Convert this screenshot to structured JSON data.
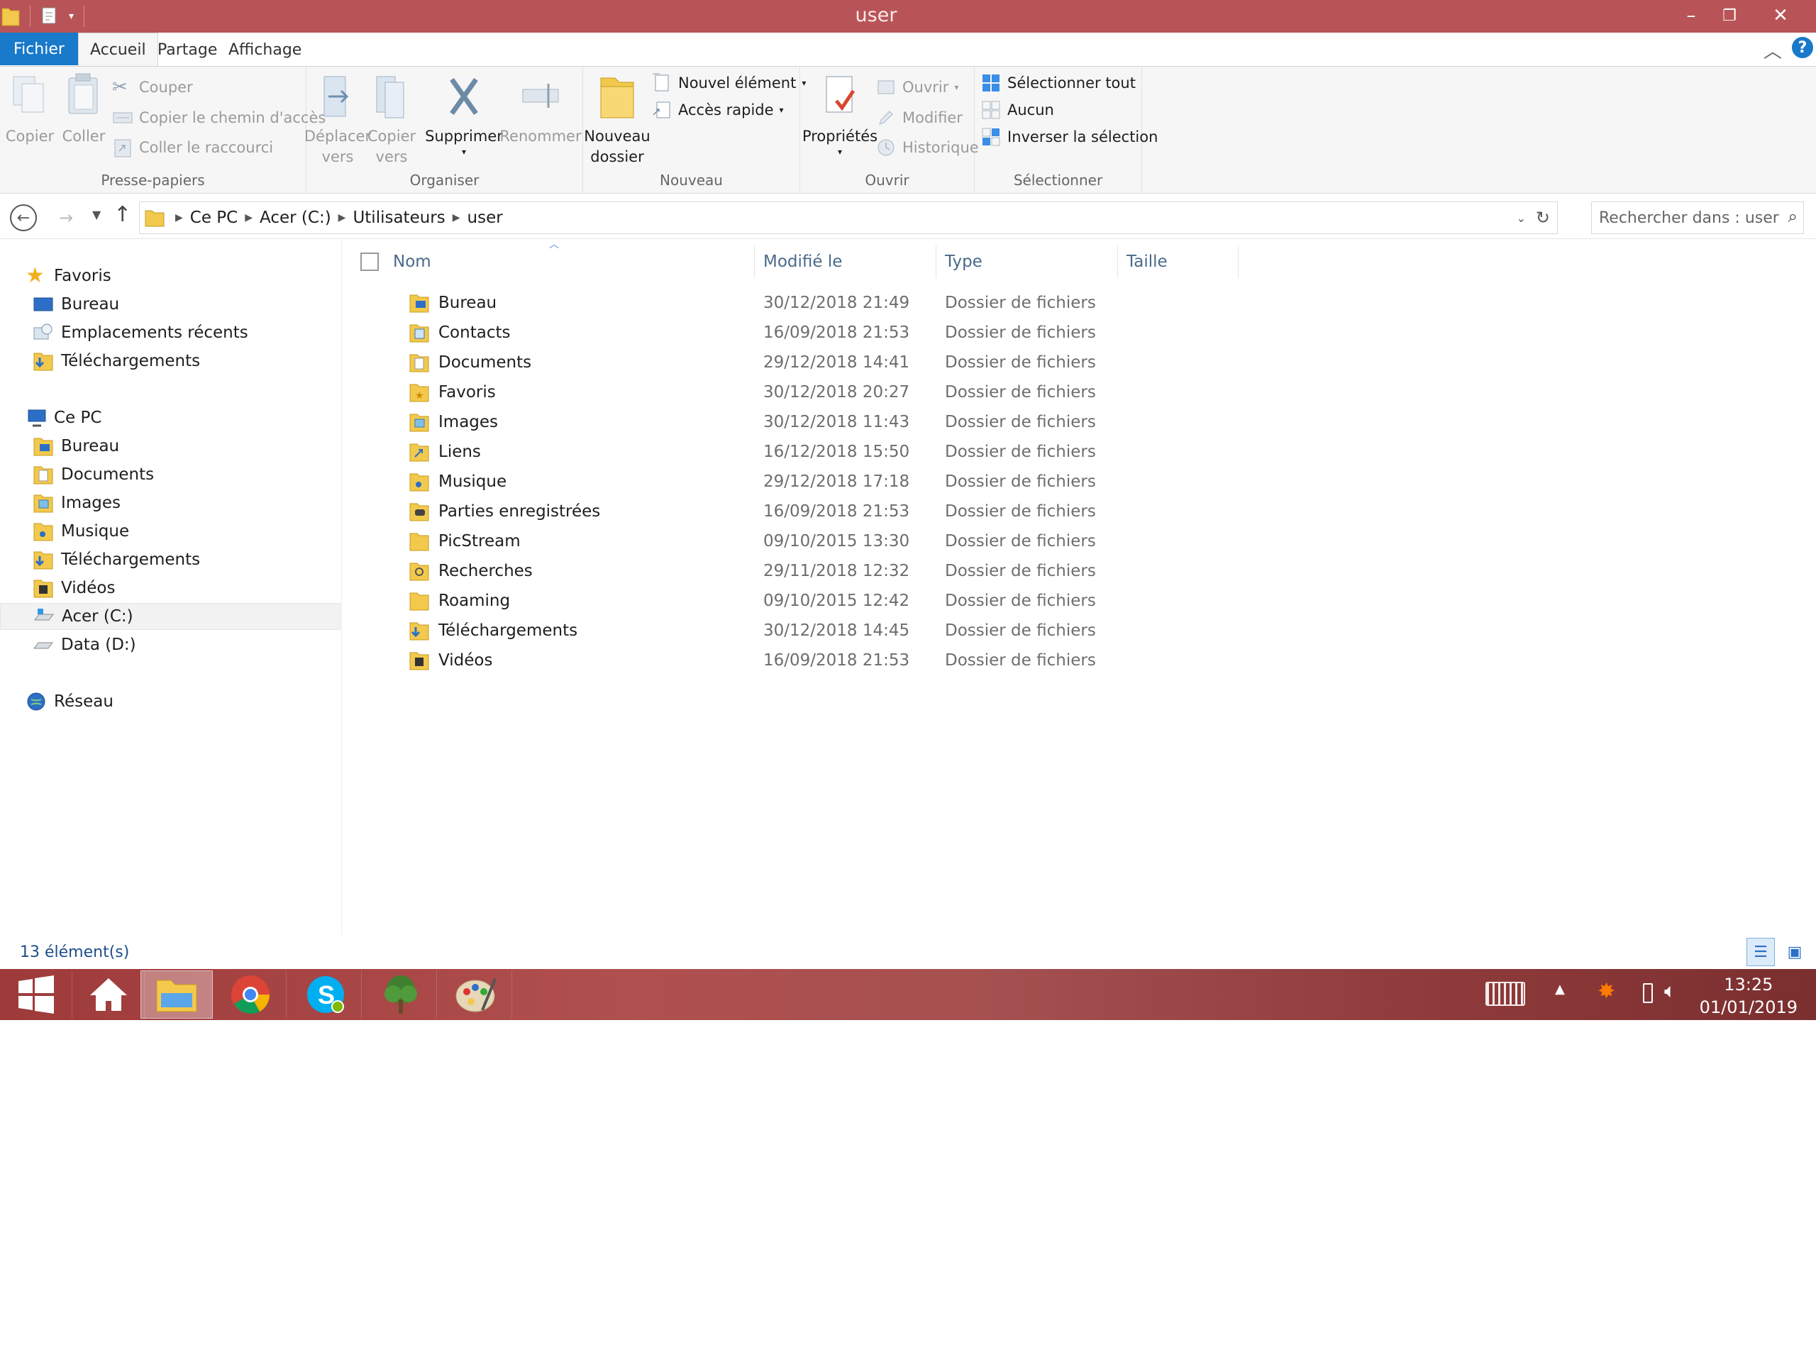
{
  "window": {
    "title": "user"
  },
  "colors": {
    "titlebar": "#b85457",
    "accent": "#1979ca",
    "taskbar": "#9e3a3a"
  },
  "ribbon_tabs": [
    "Fichier",
    "Accueil",
    "Partage",
    "Affichage"
  ],
  "ribbon": {
    "presse_papiers": {
      "label": "Presse-papiers",
      "copier": "Copier",
      "coller": "Coller",
      "couper": "Couper",
      "copier_chemin": "Copier le chemin d'accès",
      "coller_raccourci": "Coller le raccourci"
    },
    "organiser": {
      "label": "Organiser",
      "deplacer_1": "Déplacer",
      "deplacer_2": "vers",
      "copier_1": "Copier",
      "copier_2": "vers",
      "supprimer": "Supprimer",
      "renommer": "Renommer"
    },
    "nouveau": {
      "label": "Nouveau",
      "dossier_1": "Nouveau",
      "dossier_2": "dossier",
      "element": "Nouvel élément",
      "acces": "Accès rapide"
    },
    "ouvrir": {
      "label": "Ouvrir",
      "proprietes": "Propriétés",
      "ouvrir": "Ouvrir",
      "modifier": "Modifier",
      "historique": "Historique"
    },
    "selectionner": {
      "label": "Sélectionner",
      "tout": "Sélectionner tout",
      "aucun": "Aucun",
      "inverser": "Inverser la sélection"
    }
  },
  "address": {
    "crumbs": [
      "Ce PC",
      "Acer (C:)",
      "Utilisateurs",
      "user"
    ],
    "search_placeholder": "Rechercher dans : user"
  },
  "nav": {
    "favoris": "Favoris",
    "fav_items": [
      "Bureau",
      "Emplacements récents",
      "Téléchargements"
    ],
    "ce_pc": "Ce PC",
    "pc_items": [
      "Bureau",
      "Documents",
      "Images",
      "Musique",
      "Téléchargements",
      "Vidéos",
      "Acer (C:)",
      "Data (D:)"
    ],
    "reseau": "Réseau"
  },
  "columns": {
    "name": "Nom",
    "modified": "Modifié le",
    "type": "Type",
    "size": "Taille"
  },
  "files": [
    {
      "name": "Bureau",
      "date": "30/12/2018 21:49",
      "type": "Dossier de fichiers"
    },
    {
      "name": "Contacts",
      "date": "16/09/2018 21:53",
      "type": "Dossier de fichiers"
    },
    {
      "name": "Documents",
      "date": "29/12/2018 14:41",
      "type": "Dossier de fichiers"
    },
    {
      "name": "Favoris",
      "date": "30/12/2018 20:27",
      "type": "Dossier de fichiers"
    },
    {
      "name": "Images",
      "date": "30/12/2018 11:43",
      "type": "Dossier de fichiers"
    },
    {
      "name": "Liens",
      "date": "16/12/2018 15:50",
      "type": "Dossier de fichiers"
    },
    {
      "name": "Musique",
      "date": "29/12/2018 17:18",
      "type": "Dossier de fichiers"
    },
    {
      "name": "Parties enregistrées",
      "date": "16/09/2018 21:53",
      "type": "Dossier de fichiers"
    },
    {
      "name": "PicStream",
      "date": "09/10/2015 13:30",
      "type": "Dossier de fichiers"
    },
    {
      "name": "Recherches",
      "date": "29/11/2018 12:32",
      "type": "Dossier de fichiers"
    },
    {
      "name": "Roaming",
      "date": "09/10/2015 12:42",
      "type": "Dossier de fichiers"
    },
    {
      "name": "Téléchargements",
      "date": "30/12/2018 14:45",
      "type": "Dossier de fichiers"
    },
    {
      "name": "Vidéos",
      "date": "16/09/2018 21:53",
      "type": "Dossier de fichiers"
    }
  ],
  "status": {
    "count": "13 élément(s)"
  },
  "taskbar": {
    "time": "13:25",
    "date": "01/01/2019"
  }
}
